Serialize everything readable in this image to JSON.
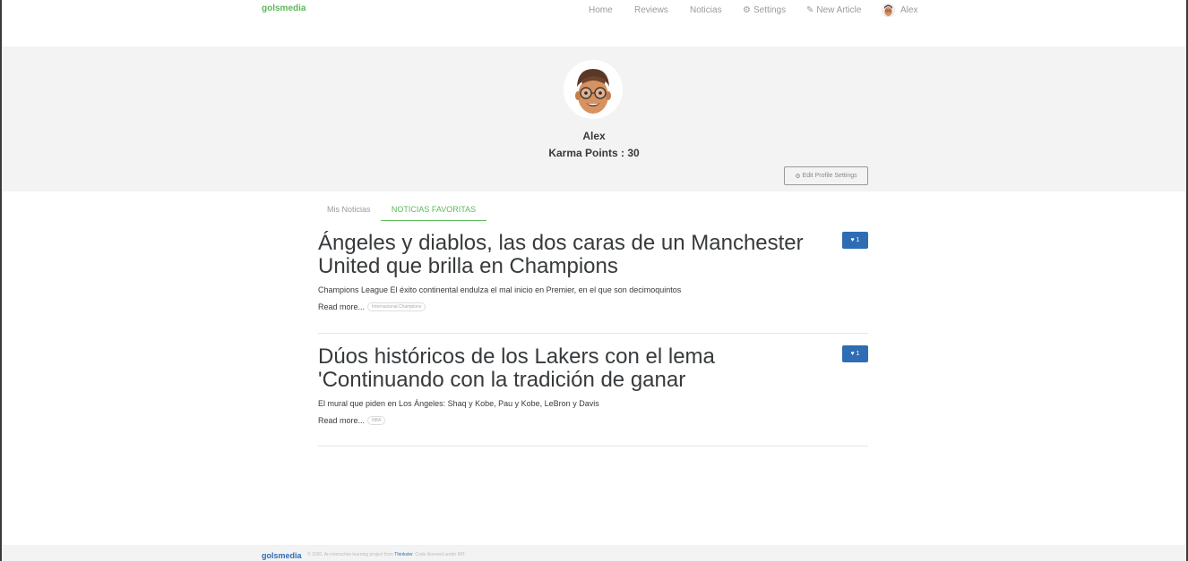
{
  "navbar": {
    "brand": "golsmedia",
    "links": {
      "home": "Home",
      "reviews": "Reviews",
      "noticias": "Noticias",
      "settings": "Settings",
      "new_article": "New Article",
      "user": "Alex"
    }
  },
  "profile": {
    "username": "Alex",
    "karma": "Karma Points : 30",
    "edit_button": "Edit Profile Settings"
  },
  "tabs": {
    "mine": "Mis Noticias",
    "favorites": "NOTICIAS FAVORITAS"
  },
  "articles": [
    {
      "title": "Ángeles y diablos, las dos caras de un Manchester United que brilla en Champions",
      "description": "Champions League El éxito continental endulza el mal inicio en Premier, en el que son decimoquintos",
      "read_more": "Read more...",
      "tag": "Internacional,Champions",
      "favorites": "1"
    },
    {
      "title": "Dúos históricos de los Lakers con el lema 'Continuando con la tradición de ganar",
      "description": "El mural que piden en Los Ángeles: Shaq y Kobe, Pau y Kobe, LeBron y Davis",
      "read_more": "Read more...",
      "tag": "NBA",
      "favorites": "1"
    }
  ],
  "footer": {
    "brand": "golsmedia",
    "text_before": "© 2020. An interactive learning project from",
    "link": "Thinkster",
    "text_after": ". Code licensed under MIT."
  },
  "colors": {
    "brand_green": "#5cb85c",
    "primary_blue": "#2e6db4",
    "banner_bg": "#f3f3f3"
  },
  "icons": {
    "settings": "gear-icon",
    "new_article": "edit-icon",
    "favorite": "heart-icon"
  }
}
